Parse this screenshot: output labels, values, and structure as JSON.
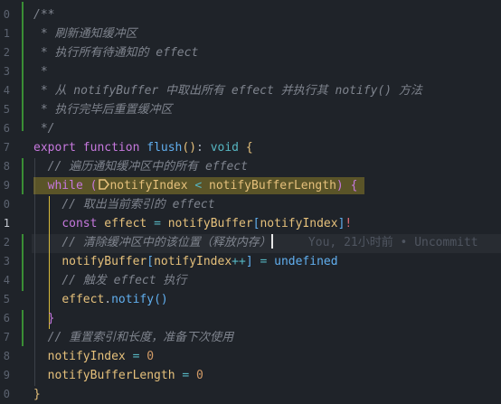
{
  "editor": {
    "line_numbers": [
      "5",
      "0",
      "1",
      "2",
      "3",
      "4",
      "5",
      "6",
      "7",
      "8",
      "9",
      "0",
      "1",
      "2",
      "3",
      "4",
      "5",
      "6",
      "7",
      "8",
      "9",
      "0"
    ],
    "active_line_index": 12,
    "blame": "You, 21小时前 • Uncommitt",
    "lines": [
      [
        {
          "t": "c",
          "s": "/**"
        }
      ],
      [
        {
          "t": "c",
          "s": " * 刷新通知缓冲区"
        }
      ],
      [
        {
          "t": "c",
          "s": " * 执行所有待通知的 effect"
        }
      ],
      [
        {
          "t": "c",
          "s": " *"
        }
      ],
      [
        {
          "t": "c",
          "s": " * 从 notifyBuffer 中取出所有 effect 并执行其 notify() 方法"
        }
      ],
      [
        {
          "t": "c",
          "s": " * 执行完毕后重置缓冲区"
        }
      ],
      [
        {
          "t": "c",
          "s": " */"
        }
      ],
      [
        {
          "t": "k",
          "s": "export"
        },
        {
          "t": "p",
          "s": " "
        },
        {
          "t": "k",
          "s": "function"
        },
        {
          "t": "p",
          "s": " "
        },
        {
          "t": "f",
          "s": "flush"
        },
        {
          "t": "b1",
          "s": "()"
        },
        {
          "t": "p",
          "s": ": "
        },
        {
          "t": "o",
          "s": "void"
        },
        {
          "t": "p",
          "s": " "
        },
        {
          "t": "b1",
          "s": "{"
        }
      ],
      [
        {
          "t": "p",
          "s": "  "
        },
        {
          "t": "c",
          "s": "// 遍历通知缓冲区中的所有 effect"
        }
      ],
      [
        {
          "t": "p",
          "s": "  "
        },
        {
          "t": "k",
          "s": "while"
        },
        {
          "t": "p",
          "s": " "
        },
        {
          "t": "b2",
          "s": "("
        },
        {
          "t": "icon",
          "s": ""
        },
        {
          "t": "v",
          "s": "notifyIndex"
        },
        {
          "t": "p",
          "s": " "
        },
        {
          "t": "o",
          "s": "<"
        },
        {
          "t": "p",
          "s": " "
        },
        {
          "t": "v",
          "s": "notifyBufferLength"
        },
        {
          "t": "b2",
          "s": ")"
        },
        {
          "t": "p",
          "s": " "
        },
        {
          "t": "b2",
          "s": "{"
        }
      ],
      [
        {
          "t": "p",
          "s": "    "
        },
        {
          "t": "c",
          "s": "// 取出当前索引的 effect"
        }
      ],
      [
        {
          "t": "p",
          "s": "    "
        },
        {
          "t": "k",
          "s": "const"
        },
        {
          "t": "p",
          "s": " "
        },
        {
          "t": "v",
          "s": "effect"
        },
        {
          "t": "p",
          "s": " "
        },
        {
          "t": "o",
          "s": "="
        },
        {
          "t": "p",
          "s": " "
        },
        {
          "t": "v",
          "s": "notifyBuffer"
        },
        {
          "t": "b3",
          "s": "["
        },
        {
          "t": "v",
          "s": "notifyIndex"
        },
        {
          "t": "b3",
          "s": "]"
        },
        {
          "t": "bang",
          "s": "!"
        }
      ],
      [
        {
          "t": "p",
          "s": "    "
        },
        {
          "t": "c",
          "s": "// 清除缓冲区中的该位置（释放内存）"
        },
        {
          "t": "cursor",
          "s": ""
        }
      ],
      [
        {
          "t": "p",
          "s": "    "
        },
        {
          "t": "v",
          "s": "notifyBuffer"
        },
        {
          "t": "b3",
          "s": "["
        },
        {
          "t": "v",
          "s": "notifyIndex"
        },
        {
          "t": "o",
          "s": "++"
        },
        {
          "t": "b3",
          "s": "]"
        },
        {
          "t": "p",
          "s": " "
        },
        {
          "t": "o",
          "s": "="
        },
        {
          "t": "p",
          "s": " "
        },
        {
          "t": "f",
          "s": "undefined"
        }
      ],
      [
        {
          "t": "p",
          "s": "    "
        },
        {
          "t": "c",
          "s": "// 触发 effect 执行"
        }
      ],
      [
        {
          "t": "p",
          "s": "    "
        },
        {
          "t": "v",
          "s": "effect"
        },
        {
          "t": "p",
          "s": "."
        },
        {
          "t": "f",
          "s": "notify"
        },
        {
          "t": "b3",
          "s": "()"
        }
      ],
      [
        {
          "t": "p",
          "s": "  "
        },
        {
          "t": "b2",
          "s": "}"
        }
      ],
      [
        {
          "t": "p",
          "s": "  "
        },
        {
          "t": "c",
          "s": "// 重置索引和长度，准备下次使用"
        }
      ],
      [
        {
          "t": "p",
          "s": "  "
        },
        {
          "t": "v",
          "s": "notifyIndex"
        },
        {
          "t": "p",
          "s": " "
        },
        {
          "t": "o",
          "s": "="
        },
        {
          "t": "p",
          "s": " "
        },
        {
          "t": "n",
          "s": "0"
        }
      ],
      [
        {
          "t": "p",
          "s": "  "
        },
        {
          "t": "v",
          "s": "notifyBufferLength"
        },
        {
          "t": "p",
          "s": " "
        },
        {
          "t": "o",
          "s": "="
        },
        {
          "t": "p",
          "s": " "
        },
        {
          "t": "n",
          "s": "0"
        }
      ],
      [
        {
          "t": "b1",
          "s": "}"
        }
      ],
      [
        {
          "t": "p",
          "s": ""
        }
      ]
    ]
  }
}
